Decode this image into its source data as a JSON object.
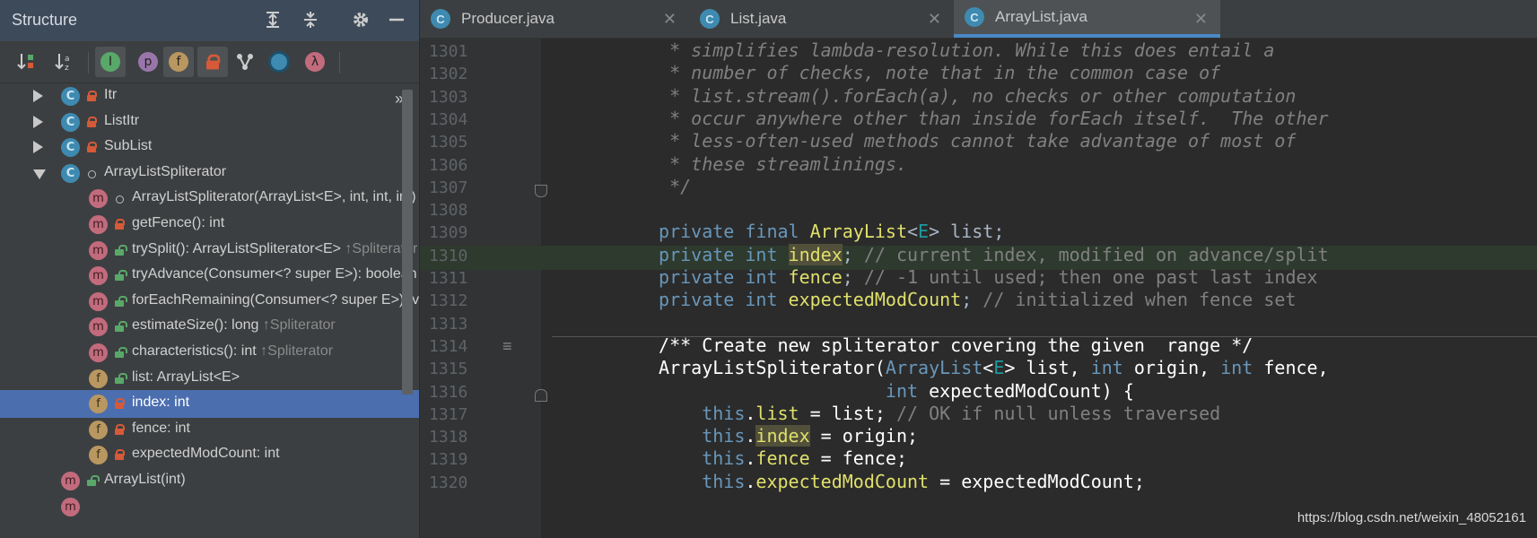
{
  "structure": {
    "title": "Structure",
    "more": "»",
    "tree": [
      {
        "label": "Itr",
        "kind": "c",
        "vis": "lock",
        "arrow": "right",
        "indent": 0
      },
      {
        "label": "ListItr",
        "kind": "c",
        "vis": "lock",
        "arrow": "right",
        "indent": 0
      },
      {
        "label": "SubList",
        "kind": "c",
        "vis": "lock",
        "arrow": "right",
        "indent": 0
      },
      {
        "label": "ArrayListSpliterator",
        "kind": "c",
        "vis": "dot",
        "arrow": "down",
        "indent": 0
      },
      {
        "label": "ArrayListSpliterator(ArrayList<E>, int, int, int)",
        "kind": "m",
        "vis": "dot",
        "indent": 1
      },
      {
        "label": "getFence(): int",
        "kind": "m",
        "vis": "lock",
        "indent": 1
      },
      {
        "label": "trySplit(): ArrayListSpliterator<E>",
        "suffix": "↑Spliterator",
        "kind": "m",
        "vis": "unlock",
        "indent": 1
      },
      {
        "label": "tryAdvance(Consumer<? super E>): boolean",
        "kind": "m",
        "vis": "unlock",
        "indent": 1
      },
      {
        "label": "forEachRemaining(Consumer<? super E>): void",
        "kind": "m",
        "vis": "unlock",
        "indent": 1
      },
      {
        "label": "estimateSize(): long",
        "suffix": "↑Spliterator",
        "kind": "m",
        "vis": "unlock",
        "indent": 1
      },
      {
        "label": "characteristics(): int",
        "suffix": "↑Spliterator",
        "kind": "m",
        "vis": "unlock",
        "indent": 1
      },
      {
        "label": "list: ArrayList<E>",
        "kind": "f",
        "vis": "unlock",
        "indent": 1
      },
      {
        "label": "index: int",
        "kind": "f",
        "vis": "lock",
        "indent": 1,
        "selected": true
      },
      {
        "label": "fence: int",
        "kind": "f",
        "vis": "lock",
        "indent": 1
      },
      {
        "label": "expectedModCount: int",
        "kind": "f",
        "vis": "lock",
        "indent": 1
      },
      {
        "label": "ArrayList(int)",
        "kind": "m",
        "vis": "unlock",
        "indent": 0
      },
      {
        "label": "",
        "kind": "m",
        "vis": "none",
        "indent": 0
      }
    ]
  },
  "tabs": [
    {
      "label": "Producer.java",
      "active": false
    },
    {
      "label": "List.java",
      "active": false
    },
    {
      "label": "ArrayList.java",
      "active": true
    }
  ],
  "editor": {
    "line_numbers": [
      "1301",
      "1302",
      "1303",
      "1304",
      "1305",
      "1306",
      "1307",
      "1308",
      "1309",
      "1310",
      "1311",
      "1312",
      "1313",
      "1314",
      "1315",
      "1316",
      "1317",
      "1318",
      "1319",
      "1320"
    ],
    "lines": [
      [
        {
          "t": "  * simplifies lambda-resolution. While this does entail a",
          "c": "cm"
        }
      ],
      [
        {
          "t": "  * number of checks, note that in the common case of",
          "c": "cm"
        }
      ],
      [
        {
          "t": "  * list.stream().forEach(a), no checks or other computation",
          "c": "cm"
        }
      ],
      [
        {
          "t": "  * occur anywhere other than inside forEach itself.  The other",
          "c": "cm"
        }
      ],
      [
        {
          "t": "  * less-often-used methods cannot take advantage of most of",
          "c": "cm"
        }
      ],
      [
        {
          "t": "  * these streamlinings.",
          "c": "cm"
        }
      ],
      [
        {
          "t": "  */",
          "c": "cm"
        }
      ],
      [],
      [
        {
          "t": " private ",
          "c": "kw"
        },
        {
          "t": "final ",
          "c": "kw"
        },
        {
          "t": "ArrayList",
          "c": "typ2"
        },
        {
          "t": "<",
          "c": "typ"
        },
        {
          "t": "E",
          "c": "tp"
        },
        {
          "t": "> list;",
          "c": "typ"
        }
      ],
      [
        {
          "t": " private ",
          "c": "kw"
        },
        {
          "t": "int ",
          "c": "kw"
        },
        {
          "t": "index",
          "c": "id-hl"
        },
        {
          "t": "; ",
          "c": "typ"
        },
        {
          "t": "// current index, modified on advance/split",
          "c": "lc"
        }
      ],
      [
        {
          "t": " private ",
          "c": "kw"
        },
        {
          "t": "int ",
          "c": "kw"
        },
        {
          "t": "fence",
          "c": "typ2"
        },
        {
          "t": "; ",
          "c": "typ"
        },
        {
          "t": "// -1 until used; then one past last index",
          "c": "lc"
        }
      ],
      [
        {
          "t": " private ",
          "c": "kw"
        },
        {
          "t": "int ",
          "c": "kw"
        },
        {
          "t": "expectedModCount",
          "c": "typ2"
        },
        {
          "t": "; ",
          "c": "typ"
        },
        {
          "t": "// initialized when fence set",
          "c": "lc"
        }
      ],
      [],
      [
        {
          "t": " /** Create new spliterator covering the given  range */",
          "c": "plain"
        }
      ],
      [
        {
          "t": " ArrayListSpliterator(",
          "c": "plain"
        },
        {
          "t": "ArrayList",
          "c": "kw"
        },
        {
          "t": "<",
          "c": "plain"
        },
        {
          "t": "E",
          "c": "tp"
        },
        {
          "t": "> list, ",
          "c": "plain"
        },
        {
          "t": "int ",
          "c": "kw"
        },
        {
          "t": "origin, ",
          "c": "plain"
        },
        {
          "t": "int ",
          "c": "kw"
        },
        {
          "t": "fence,",
          "c": "plain"
        }
      ],
      [
        {
          "t": "                      ",
          "c": "plain"
        },
        {
          "t": "int ",
          "c": "kw"
        },
        {
          "t": "expectedModCount) {",
          "c": "plain"
        }
      ],
      [
        {
          "t": "     this",
          "c": "kw"
        },
        {
          "t": ".",
          "c": "plain"
        },
        {
          "t": "list",
          "c": "typ2"
        },
        {
          "t": " = list; ",
          "c": "plain"
        },
        {
          "t": "// OK if null unless traversed",
          "c": "lc"
        }
      ],
      [
        {
          "t": "     this",
          "c": "kw"
        },
        {
          "t": ".",
          "c": "plain"
        },
        {
          "t": "index",
          "c": "id-hl"
        },
        {
          "t": " = origin;",
          "c": "plain"
        }
      ],
      [
        {
          "t": "     this",
          "c": "kw"
        },
        {
          "t": ".",
          "c": "plain"
        },
        {
          "t": "fence",
          "c": "typ2"
        },
        {
          "t": " = fence;",
          "c": "plain"
        }
      ],
      [
        {
          "t": "     this",
          "c": "kw"
        },
        {
          "t": ".",
          "c": "plain"
        },
        {
          "t": "expectedModCount",
          "c": "typ2"
        },
        {
          "t": " = expectedModCount;",
          "c": "plain"
        }
      ]
    ]
  },
  "watermark": "https://blog.csdn.net/weixin_48052161"
}
